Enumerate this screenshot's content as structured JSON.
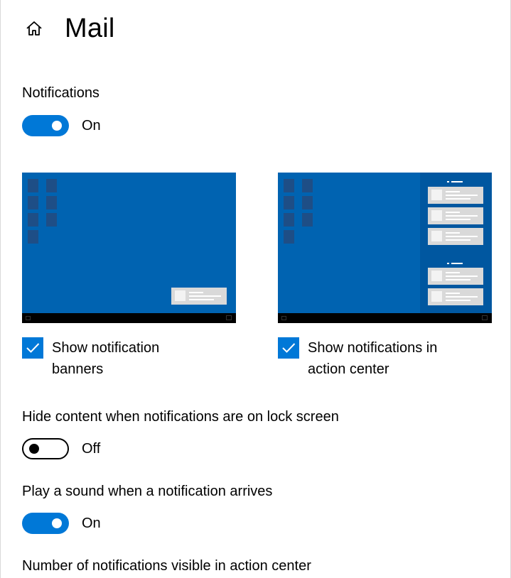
{
  "app": {
    "title": "Mail",
    "home_icon": "home-icon"
  },
  "accent_color": "#0078d7",
  "notifications": {
    "label": "Notifications",
    "state": "On",
    "enabled": true
  },
  "previews": {
    "banners": {
      "label": "Show notification banners",
      "checked": true
    },
    "action_center": {
      "label": "Show notifications in action center",
      "checked": true
    }
  },
  "hide_content": {
    "label": "Hide content when notifications are on lock screen",
    "state": "Off",
    "enabled": false
  },
  "play_sound": {
    "label": "Play a sound when a notification arrives",
    "state": "On",
    "enabled": true
  },
  "visible_count": {
    "label": "Number of notifications visible in action center"
  }
}
